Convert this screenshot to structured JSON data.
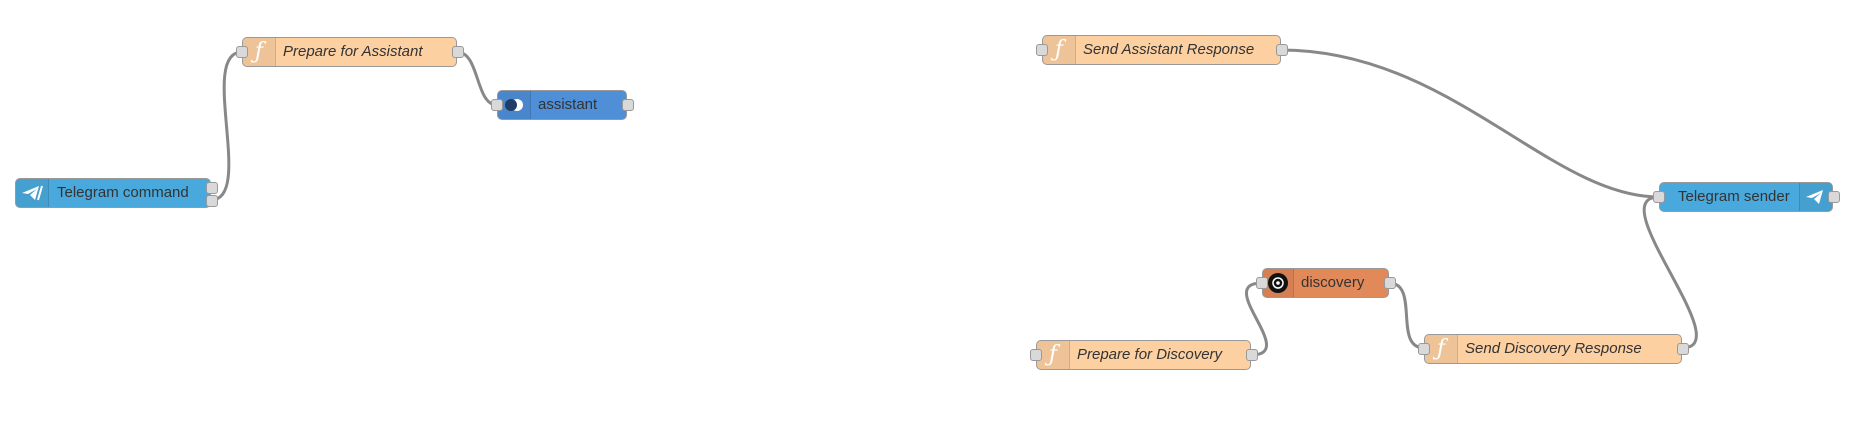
{
  "colors": {
    "function": "#fdd0a2",
    "telegram": "#3fadb5",
    "telegram_blue": "#4aa9dc",
    "assistant": "#4f8fd8",
    "discovery": "#e2895a",
    "wire": "#888888",
    "port": "#d9d9d9"
  },
  "nodes": {
    "telegram_command": {
      "label": "Telegram command",
      "icon": "telegram-icon"
    },
    "prepare_assistant": {
      "label": "Prepare for Assistant",
      "icon": "function-icon"
    },
    "assistant": {
      "label": "assistant",
      "icon": "toggle-icon"
    },
    "send_assistant_response": {
      "label": "Send Assistant Response",
      "icon": "function-icon"
    },
    "telegram_sender": {
      "label": "Telegram sender",
      "icon": "telegram-icon"
    },
    "discovery": {
      "label": "discovery",
      "icon": "discovery-icon"
    },
    "prepare_discovery": {
      "label": "Prepare for Discovery",
      "icon": "function-icon"
    },
    "send_discovery_response": {
      "label": "Send Discovery Response",
      "icon": "function-icon"
    }
  }
}
